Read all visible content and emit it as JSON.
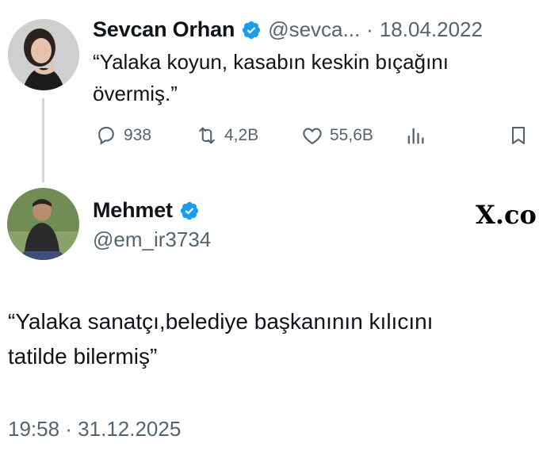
{
  "quoted_tweet": {
    "author_name": "Sevcan Orhan",
    "handle": "@sevca...",
    "separator": "·",
    "date": "18.04.2022",
    "text_line1": "“Yalaka koyun, kasabın keskin bıçağını",
    "text_line2": "övermiş.”",
    "actions": {
      "replies": "938",
      "retweets": "4,2B",
      "likes": "55,6B"
    },
    "icons": [
      "reply-icon",
      "retweet-icon",
      "like-icon",
      "views-icon",
      "bookmark-icon"
    ]
  },
  "reply_tweet": {
    "author_name": "Mehmet",
    "handle": "@em_ir3734",
    "brand_mark": "X.co",
    "text_line1": "“Yalaka sanatçı,belediye başkanının kılıcını",
    "text_line2": "tatilde bilermiş”",
    "timestamp": "19:58 · 31.12.2025"
  },
  "colors": {
    "verified_blue": "#1d9bf0",
    "muted_text": "#536471",
    "thread_line": "#cfd9de"
  }
}
